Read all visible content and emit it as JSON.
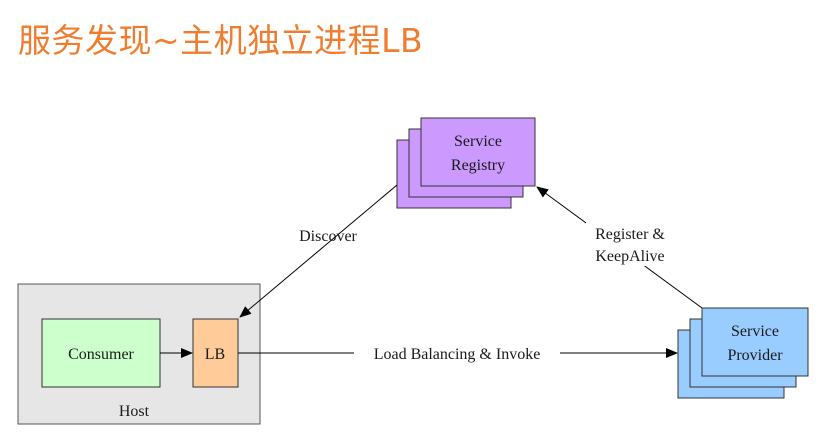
{
  "title": "服务发现~主机独立进程LB",
  "registry": {
    "line1": "Service",
    "line2": "Registry",
    "color": "#cc99ff"
  },
  "provider": {
    "line1": "Service",
    "line2": "Provider",
    "color": "#99ccff"
  },
  "consumer": {
    "label": "Consumer",
    "color": "#ccffcc"
  },
  "lb": {
    "label": "LB",
    "color": "#ffcc99"
  },
  "host": {
    "label": "Host",
    "color": "#e6e6e6"
  },
  "edges": {
    "discover": "Discover",
    "register_line1": "Register &",
    "register_line2": "KeepAlive",
    "invoke": "Load Balancing & Invoke"
  }
}
